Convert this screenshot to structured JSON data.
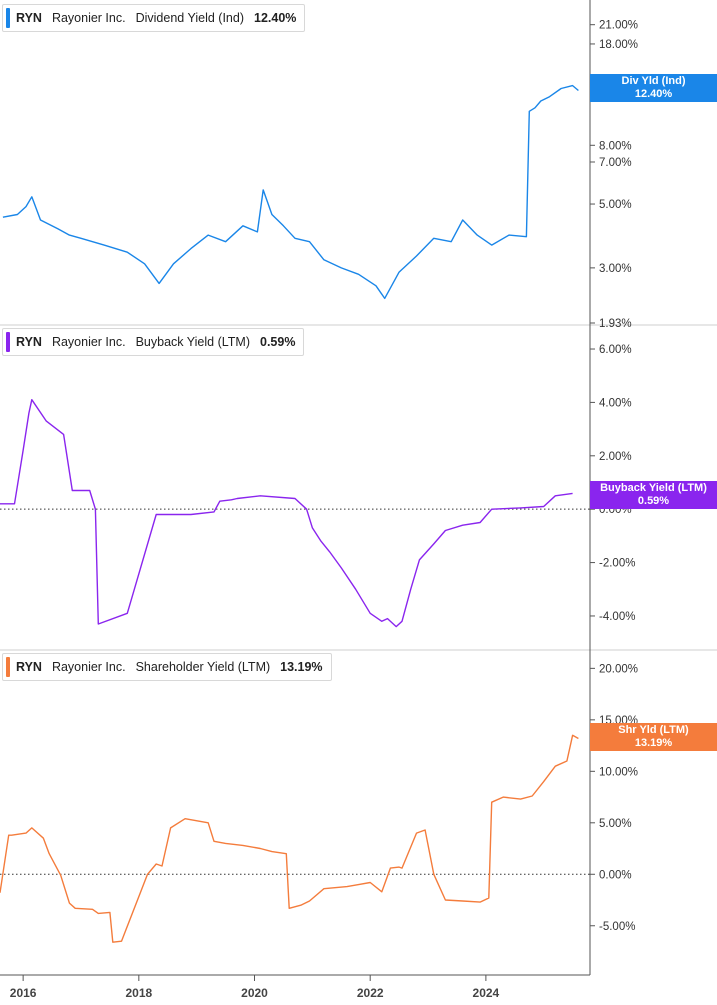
{
  "chart_data": [
    {
      "type": "line",
      "ticker": "RYN",
      "company": "Rayonier Inc.",
      "metric": "Dividend Yield (Ind)",
      "current_value": "12.40%",
      "tag_label": "Div Yld (Ind)",
      "color": "#1a86e8",
      "scale": "log",
      "ylim": [
        1.93,
        24.0
      ],
      "yticks": [
        {
          "v": 21,
          "label": "21.00%"
        },
        {
          "v": 18,
          "label": "18.00%"
        },
        {
          "v": 8,
          "label": "8.00%"
        },
        {
          "v": 7,
          "label": "7.00%"
        },
        {
          "v": 5,
          "label": "5.00%"
        },
        {
          "v": 3,
          "label": "3.00%"
        },
        {
          "v": 1.93,
          "label": "1.93%"
        }
      ],
      "zero_line": false,
      "x": [
        2015.65,
        2015.9,
        2016.05,
        2016.15,
        2016.3,
        2016.6,
        2016.8,
        2017.0,
        2017.4,
        2017.8,
        2018.1,
        2018.35,
        2018.6,
        2018.9,
        2019.2,
        2019.5,
        2019.8,
        2020.05,
        2020.15,
        2020.3,
        2020.5,
        2020.7,
        2020.95,
        2021.2,
        2021.5,
        2021.8,
        2022.1,
        2022.25,
        2022.5,
        2022.8,
        2023.1,
        2023.4,
        2023.6,
        2023.85,
        2024.1,
        2024.4,
        2024.7,
        2024.75,
        2024.85,
        2024.95,
        2025.1,
        2025.3,
        2025.5,
        2025.6
      ],
      "y": [
        4.5,
        4.6,
        4.9,
        5.3,
        4.4,
        4.1,
        3.9,
        3.8,
        3.6,
        3.4,
        3.1,
        2.65,
        3.1,
        3.5,
        3.9,
        3.7,
        4.2,
        4.0,
        5.6,
        4.6,
        4.2,
        3.8,
        3.7,
        3.2,
        3.0,
        2.85,
        2.6,
        2.35,
        2.9,
        3.3,
        3.8,
        3.7,
        4.4,
        3.9,
        3.6,
        3.9,
        3.85,
        10.5,
        10.8,
        11.4,
        11.8,
        12.6,
        12.9,
        12.4
      ]
    },
    {
      "type": "line",
      "ticker": "RYN",
      "company": "Rayonier Inc.",
      "metric": "Buyback Yield (LTM)",
      "current_value": "0.59%",
      "tag_label": "Buyback Yield (LTM)",
      "color": "#8a25ee",
      "scale": "linear",
      "ylim": [
        -5.2,
        6.6
      ],
      "yticks": [
        {
          "v": 6,
          "label": "6.00%"
        },
        {
          "v": 4,
          "label": "4.00%"
        },
        {
          "v": 2,
          "label": "2.00%"
        },
        {
          "v": 0,
          "label": "0.00%"
        },
        {
          "v": -2,
          "label": "-2.00%"
        },
        {
          "v": -4,
          "label": "-4.00%"
        }
      ],
      "zero_line": true,
      "x": [
        2015.6,
        2015.8,
        2015.85,
        2016.0,
        2016.1,
        2016.15,
        2016.4,
        2016.7,
        2016.85,
        2017.15,
        2017.25,
        2017.3,
        2017.8,
        2018.3,
        2018.4,
        2018.9,
        2019.3,
        2019.4,
        2019.6,
        2019.7,
        2020.1,
        2020.7,
        2020.9,
        2021.0,
        2021.15,
        2021.3,
        2021.5,
        2021.75,
        2022.0,
        2022.2,
        2022.3,
        2022.45,
        2022.55,
        2022.7,
        2022.85,
        2023.1,
        2023.3,
        2023.6,
        2023.9,
        2024.1,
        2024.6,
        2025.0,
        2025.2,
        2025.5
      ],
      "y": [
        0.2,
        0.2,
        0.2,
        2.2,
        3.6,
        4.1,
        3.3,
        2.8,
        0.7,
        0.7,
        0.0,
        -4.3,
        -3.9,
        -0.2,
        -0.2,
        -0.2,
        -0.1,
        0.3,
        0.35,
        0.4,
        0.5,
        0.4,
        0.0,
        -0.7,
        -1.2,
        -1.6,
        -2.2,
        -3.0,
        -3.9,
        -4.2,
        -4.1,
        -4.4,
        -4.2,
        -3.0,
        -1.9,
        -1.3,
        -0.8,
        -0.6,
        -0.5,
        0.0,
        0.05,
        0.1,
        0.5,
        0.59
      ]
    },
    {
      "type": "line",
      "ticker": "RYN",
      "company": "Rayonier Inc.",
      "metric": "Shareholder Yield (LTM)",
      "current_value": "13.19%",
      "tag_label": "Shr Yld (LTM)",
      "color": "#f47c3c",
      "scale": "linear",
      "ylim": [
        -9.2,
        21.2
      ],
      "yticks": [
        {
          "v": 20,
          "label": "20.00%"
        },
        {
          "v": 15,
          "label": "15.00%"
        },
        {
          "v": 10,
          "label": "10.00%"
        },
        {
          "v": 5,
          "label": "5.00%"
        },
        {
          "v": 0,
          "label": "0.00%"
        },
        {
          "v": -5,
          "label": "-5.00%"
        }
      ],
      "zero_line": true,
      "x": [
        2015.6,
        2015.75,
        2015.8,
        2016.05,
        2016.15,
        2016.35,
        2016.45,
        2016.65,
        2016.8,
        2016.9,
        2017.2,
        2017.3,
        2017.5,
        2017.55,
        2017.7,
        2018.15,
        2018.3,
        2018.4,
        2018.55,
        2018.8,
        2019.2,
        2019.3,
        2019.5,
        2019.8,
        2020.1,
        2020.3,
        2020.55,
        2020.6,
        2020.8,
        2020.95,
        2021.2,
        2021.6,
        2021.8,
        2022.0,
        2022.2,
        2022.35,
        2022.5,
        2022.55,
        2022.8,
        2022.95,
        2023.1,
        2023.3,
        2023.6,
        2023.9,
        2024.05,
        2024.1,
        2024.3,
        2024.6,
        2024.8,
        2025.0,
        2025.2,
        2025.4,
        2025.5,
        2025.6
      ],
      "y": [
        -1.8,
        3.8,
        3.8,
        4.0,
        4.5,
        3.5,
        2.0,
        -0.1,
        -2.8,
        -3.3,
        -3.4,
        -3.8,
        -3.7,
        -6.6,
        -6.5,
        0.0,
        1.0,
        0.8,
        4.5,
        5.4,
        5.0,
        3.2,
        3.0,
        2.8,
        2.5,
        2.2,
        2.0,
        -3.3,
        -3.0,
        -2.6,
        -1.4,
        -1.2,
        -1.0,
        -0.8,
        -1.7,
        0.6,
        0.7,
        0.6,
        4.0,
        4.3,
        0.0,
        -2.5,
        -2.6,
        -2.7,
        -2.3,
        7.0,
        7.5,
        7.3,
        7.6,
        9.0,
        10.5,
        11.0,
        13.5,
        13.19
      ]
    }
  ],
  "x_axis": {
    "range": [
      2015.6,
      2025.8
    ],
    "ticks": [
      {
        "v": 2016,
        "label": "2016"
      },
      {
        "v": 2018,
        "label": "2018"
      },
      {
        "v": 2020,
        "label": "2020"
      },
      {
        "v": 2022,
        "label": "2022"
      },
      {
        "v": 2024,
        "label": "2024"
      }
    ]
  }
}
